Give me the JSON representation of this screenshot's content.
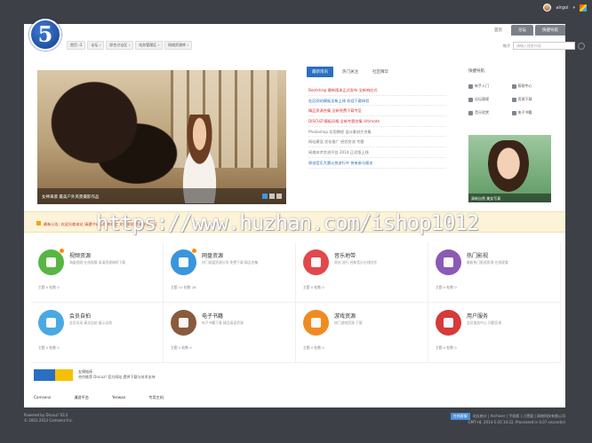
{
  "user": {
    "name": "airgol"
  },
  "logo": {
    "text": "5"
  },
  "top_nav": [
    "首页 ›3",
    "论坛 ›",
    "综合讨论区 ›",
    "站务管理区 ›",
    "网络资源库 ›"
  ],
  "top_tabs": [
    "首页",
    "论坛",
    "快捷导航"
  ],
  "search": {
    "scope": "帖子",
    "placeholder": "请输入搜索内容"
  },
  "slider": {
    "caption": "女神来袭 最美户外风景摄影作品",
    "dots": 3,
    "active_dot": 0
  },
  "news": {
    "tabs": [
      "最新资讯",
      "热门关注",
      "社区精华"
    ],
    "items": [
      {
        "text": "Bootstrap 最新版本正式发布 全新响应式",
        "tone": "red"
      },
      {
        "text": "社区网站模板全新上线 欢迎下载体验",
        "tone": "blue"
      },
      {
        "text": "精品资源合集 全新免费下载专区",
        "tone": "red"
      },
      {
        "text": "DISCUZ!模板风格 全新专题合集 Ultimate",
        "tone": "red"
      },
      {
        "text": "Photoshop 实用教程 设计素材大合集",
        "tone": "gray"
      },
      {
        "text": "网站建设 优化推广 经验交流 专题",
        "tone": "gray"
      },
      {
        "text": "网络技术交流平台 2014 正式版上线",
        "tone": "gray"
      },
      {
        "text": "原创音乐大赛火热进行中 快来参与报名",
        "tone": "blue"
      }
    ]
  },
  "quick_nav": {
    "title": "快捷导航",
    "items": [
      "新手入门",
      "帮助中心",
      "论坛版规",
      "资源下载",
      "音乐欣赏",
      "电子书籍"
    ]
  },
  "side_photo": {
    "caption": "清新自然 美女写真"
  },
  "notice": {
    "text": "最新公告: 欢迎光临本站 请遵守论坛相关规定 文明发帖 共建和谐社区"
  },
  "watermark": "https://www.huzhan.com/ishop1012",
  "categories": [
    {
      "title": "视频资源",
      "desc": "海量视频 在线观看 高清资源随时下载",
      "meta": "主题 0  帖数 0",
      "color": "c-green",
      "icon": "image-icon",
      "badge": true
    },
    {
      "title": "网盘资源",
      "desc": "热门网盘资源分享 免费下载 精品合集",
      "meta": "主题 15  帖数 28",
      "color": "c-blue",
      "icon": "monitor-icon",
      "badge": true
    },
    {
      "title": "音乐地带",
      "desc": "原创 流行 经典音乐在线欣赏",
      "meta": "主题 0  帖数 0",
      "color": "c-red",
      "icon": "music-icon",
      "badge": false
    },
    {
      "title": "热门影视",
      "desc": "最新热门影视资源 在线观看",
      "meta": "主题 0  帖数 0",
      "color": "c-purple",
      "icon": "film-icon",
      "badge": false
    },
    {
      "title": "会员自拍",
      "desc": "会员风采 真实自拍 展示自我",
      "meta": "主题 0  帖数 0",
      "color": "c-sky",
      "icon": "user-icon",
      "badge": false
    },
    {
      "title": "电子书籍",
      "desc": "电子书籍下载 精品阅读资源",
      "meta": "主题 0  帖数 0",
      "color": "c-brown",
      "icon": "book-icon",
      "badge": false
    },
    {
      "title": "游戏资源",
      "desc": "热门游戏资源 下载",
      "meta": "主题 0  帖数 0",
      "color": "c-orange",
      "icon": "gamepad-icon",
      "badge": false
    },
    {
      "title": "用户服务",
      "desc": "会员服务中心 问题反馈",
      "meta": "主题 0  帖数 0",
      "color": "c-crimson",
      "icon": "vip-icon",
      "badge": false
    }
  ],
  "partner": {
    "title": "友情链接",
    "desc": "合作推荐 Discuz! 官方网站 提供下载与技术支持"
  },
  "footer_links": [
    "Comsenz",
    "漫游平台",
    "Yeswan",
    "专用主机"
  ],
  "footer": {
    "powered": "Powered by Discuz! X3.2",
    "copyright": "© 2001-2013 Comsenz Inc.",
    "right_btn": "在线客服",
    "right_links": "站长统计 | Archiver | 手机版 | 小黑屋 | 网络科技有限公司",
    "right_time": "GMT+8, 2014-5-20 10:22, Processed in 0.07 second(s)"
  }
}
